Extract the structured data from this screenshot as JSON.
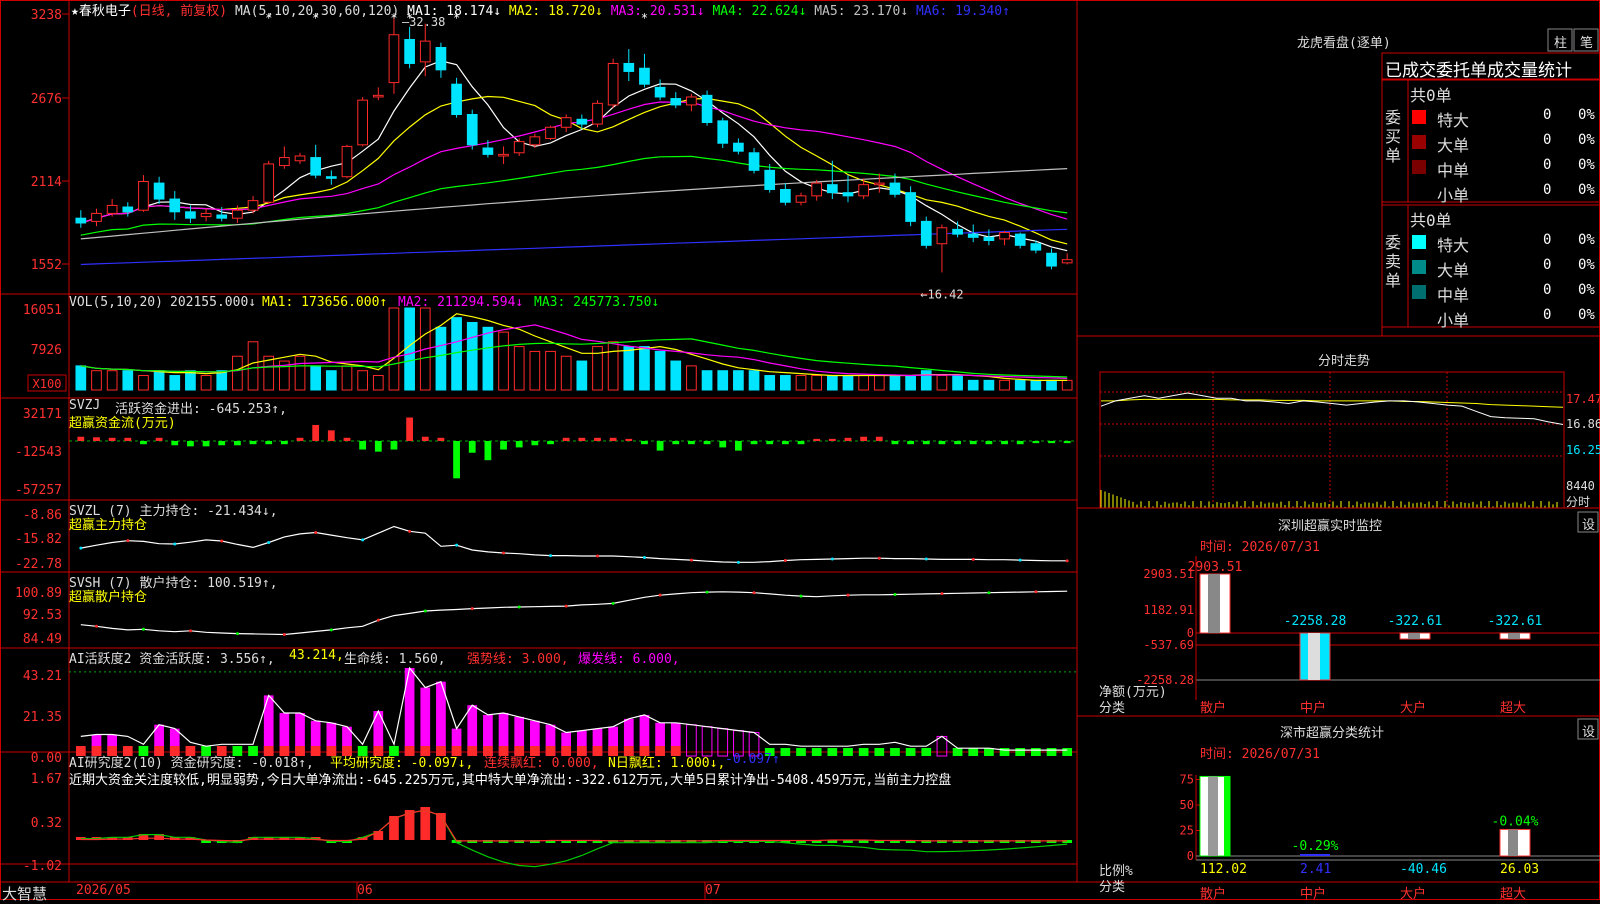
{
  "colors": {
    "up": "#ff2a2a",
    "down": "#00e5ff",
    "bg": "#000000",
    "frame": "#cc0000",
    "axis_text": "#ff3030",
    "white": "#ffffff",
    "yellow": "#ffff00",
    "magenta": "#ff00ff",
    "green": "#00ff00",
    "navy": "#3030ff",
    "gray": "#c0c0c0"
  },
  "chart_data": [
    {
      "type": "candlestick",
      "title": "★春秋电子",
      "mode": "(日线, 前复权)",
      "ma_header": "MA(5,10,20,30,60,120)",
      "ma_values": [
        {
          "label": "MA1:",
          "value": "18.174↓",
          "color": "#ffffff"
        },
        {
          "label": "MA2:",
          "value": "18.720↓",
          "color": "#ffff00"
        },
        {
          "label": "MA3:",
          "value": "20.531↓",
          "color": "#ff00ff"
        },
        {
          "label": "MA4:",
          "value": "22.624↓",
          "color": "#00ff00"
        },
        {
          "label": "MA5:",
          "value": "23.170↓",
          "color": "#c0c0c0"
        },
        {
          "label": "MA6:",
          "value": "19.340↑",
          "color": "#3030ff"
        }
      ],
      "y_ticks": [
        "3238",
        "2676",
        "2114",
        "1552"
      ],
      "high_label": "32.38",
      "low_label": "←16.42",
      "x_labels": [
        "2026/05",
        "06",
        "07"
      ],
      "ohlc": [
        [
          19.8,
          20.3,
          19.2,
          19.5
        ],
        [
          19.6,
          20.4,
          19.3,
          20.1
        ],
        [
          20.1,
          21.0,
          19.9,
          20.6
        ],
        [
          20.5,
          20.8,
          19.9,
          20.2
        ],
        [
          20.3,
          22.5,
          20.2,
          22.1
        ],
        [
          22.0,
          22.4,
          20.7,
          21.0
        ],
        [
          21.0,
          21.5,
          19.7,
          20.2
        ],
        [
          20.2,
          20.6,
          19.5,
          19.8
        ],
        [
          19.9,
          20.4,
          19.6,
          20.1
        ],
        [
          20.0,
          20.5,
          19.6,
          19.8
        ],
        [
          19.8,
          20.6,
          19.5,
          20.3
        ],
        [
          20.3,
          21.2,
          20.1,
          20.9
        ],
        [
          20.8,
          23.4,
          20.7,
          23.2
        ],
        [
          23.1,
          24.3,
          22.9,
          23.6
        ],
        [
          23.4,
          23.9,
          23.2,
          23.7
        ],
        [
          23.6,
          24.4,
          22.3,
          22.5
        ],
        [
          22.4,
          22.8,
          21.9,
          22.3
        ],
        [
          22.4,
          24.4,
          22.3,
          24.3
        ],
        [
          24.4,
          27.4,
          24.3,
          27.2
        ],
        [
          27.4,
          28.0,
          27.2,
          27.5
        ],
        [
          28.3,
          32.4,
          27.6,
          31.3
        ],
        [
          31.0,
          31.8,
          29.2,
          29.5
        ],
        [
          29.6,
          32.0,
          28.7,
          30.9
        ],
        [
          30.5,
          30.8,
          28.6,
          29.1
        ],
        [
          28.2,
          28.6,
          26.1,
          26.3
        ],
        [
          26.3,
          26.6,
          24.1,
          24.4
        ],
        [
          24.2,
          24.7,
          23.6,
          23.8
        ],
        [
          23.7,
          24.3,
          23.2,
          23.8
        ],
        [
          23.9,
          24.8,
          23.7,
          24.6
        ],
        [
          24.4,
          25.1,
          24.2,
          24.9
        ],
        [
          24.8,
          25.6,
          24.7,
          25.5
        ],
        [
          25.5,
          26.3,
          25.2,
          26.1
        ],
        [
          26.0,
          26.3,
          25.4,
          25.7
        ],
        [
          25.7,
          27.2,
          25.5,
          27.0
        ],
        [
          26.9,
          29.8,
          26.7,
          29.5
        ],
        [
          29.5,
          30.4,
          28.4,
          29.0
        ],
        [
          29.2,
          30.1,
          28.0,
          28.2
        ],
        [
          28.0,
          28.5,
          27.2,
          27.4
        ],
        [
          27.3,
          27.7,
          26.7,
          26.9
        ],
        [
          26.9,
          27.6,
          26.5,
          27.4
        ],
        [
          27.5,
          27.8,
          25.6,
          25.8
        ],
        [
          25.9,
          26.1,
          24.2,
          24.5
        ],
        [
          24.5,
          24.8,
          23.8,
          24.0
        ],
        [
          23.9,
          24.2,
          22.6,
          22.8
        ],
        [
          22.8,
          23.2,
          21.4,
          21.6
        ],
        [
          21.6,
          22.0,
          20.6,
          20.8
        ],
        [
          20.8,
          21.4,
          20.6,
          21.2
        ],
        [
          21.2,
          22.2,
          20.9,
          22.0
        ],
        [
          21.9,
          23.4,
          21.0,
          21.4
        ],
        [
          21.4,
          22.5,
          20.8,
          21.2
        ],
        [
          21.2,
          22.3,
          21.0,
          21.9
        ],
        [
          21.9,
          22.6,
          21.4,
          22.0
        ],
        [
          22.0,
          22.6,
          21.1,
          21.3
        ],
        [
          21.4,
          21.8,
          19.3,
          19.6
        ],
        [
          19.6,
          19.9,
          17.9,
          18.1
        ],
        [
          18.2,
          19.4,
          16.4,
          19.2
        ],
        [
          19.1,
          19.6,
          18.6,
          18.8
        ],
        [
          18.8,
          19.4,
          18.3,
          18.6
        ],
        [
          18.6,
          19.1,
          18.1,
          18.4
        ],
        [
          18.5,
          19.0,
          18.1,
          18.9
        ],
        [
          18.8,
          18.9,
          17.9,
          18.1
        ],
        [
          18.2,
          18.4,
          17.6,
          17.8
        ],
        [
          17.6,
          17.9,
          16.6,
          16.8
        ],
        [
          17.0,
          17.6,
          16.9,
          17.2
        ]
      ]
    },
    {
      "type": "bar",
      "title": "VOL(5,10,20)",
      "value": "202155.000↓",
      "legend": [
        {
          "label": "MA1:",
          "value": "173656.000↑",
          "color": "#ffff00"
        },
        {
          "label": "MA2:",
          "value": "211294.594↓",
          "color": "#ff00ff"
        },
        {
          "label": "MA3:",
          "value": "245773.750↓",
          "color": "#00ff00"
        }
      ],
      "y_ticks": [
        "16051",
        "7926"
      ],
      "unit_box": "X100",
      "values": [
        5,
        4,
        4,
        4,
        3,
        4,
        3,
        4,
        3,
        4,
        7,
        10,
        7,
        6,
        7,
        5,
        4,
        5,
        4,
        3,
        17,
        17,
        17,
        13,
        15,
        14,
        13,
        12,
        9,
        8,
        8,
        7,
        6,
        9,
        10,
        9,
        9,
        8,
        6,
        5,
        4,
        4,
        4,
        4,
        3,
        3,
        3,
        3,
        3,
        3,
        3,
        3,
        3,
        3,
        4,
        3,
        3,
        2,
        2,
        2,
        2,
        2,
        2,
        2
      ]
    },
    {
      "type": "bar",
      "title": "SVZJ",
      "subtitle": "超赢资金流(万元)",
      "label": "活跃资金进出:",
      "value": "-645.253↑,",
      "y_ticks": [
        "32171",
        "-12543",
        "-57257"
      ],
      "values": [
        4000,
        3500,
        3000,
        3000,
        -3000,
        3000,
        -4000,
        -5000,
        -5000,
        -4000,
        -4000,
        -3000,
        -3000,
        -3000,
        3000,
        15000,
        10000,
        3000,
        -8000,
        -10000,
        -8000,
        22000,
        4000,
        3000,
        -35000,
        -11000,
        -18000,
        -8000,
        -6000,
        -4000,
        -3000,
        3000,
        3000,
        3000,
        3000,
        2000,
        -3000,
        -9000,
        -3000,
        -3000,
        -3000,
        -6000,
        -9000,
        -3000,
        -3000,
        -3000,
        -3000,
        2000,
        2000,
        3000,
        4000,
        4000,
        -3000,
        -3000,
        -3000,
        -3000,
        -3000,
        -3000,
        -3000,
        -3000,
        -3000,
        -2000,
        -2000,
        -2000
      ]
    },
    {
      "type": "line",
      "title": "SVZL",
      "params": "(7)",
      "label": "主力持仓:",
      "value": "-21.434↓,",
      "subtitle": "超赢主力持仓",
      "y_ticks": [
        "-8.86",
        "-15.82",
        "-22.78"
      ],
      "values": [
        -18.0,
        -17.2,
        -16.5,
        -16.0,
        -16.2,
        -16.8,
        -16.9,
        -16.4,
        -15.8,
        -16.1,
        -17.0,
        -17.8,
        -16.5,
        -15.0,
        -14.2,
        -13.8,
        -14.5,
        -15.2,
        -15.8,
        -14.0,
        -12.2,
        -13.5,
        -14.0,
        -17.5,
        -17.2,
        -18.5,
        -19.0,
        -19.3,
        -19.5,
        -19.8,
        -20.0,
        -20.0,
        -20.1,
        -20.1,
        -20.1,
        -20.3,
        -20.5,
        -20.8,
        -21.0,
        -21.2,
        -21.5,
        -21.7,
        -21.8,
        -21.8,
        -21.6,
        -21.3,
        -21.1,
        -21.0,
        -20.9,
        -20.8,
        -20.7,
        -20.7,
        -20.8,
        -20.8,
        -20.9,
        -21.0,
        -21.0,
        -21.0,
        -21.1,
        -21.1,
        -21.2,
        -21.3,
        -21.4,
        -21.4
      ]
    },
    {
      "type": "line",
      "title": "SVSH",
      "params": "(7)",
      "label": "散户持仓:",
      "value": "100.519↑,",
      "subtitle": "超赢散户持仓",
      "y_ticks": [
        "100.89",
        "92.53",
        "84.49"
      ],
      "values": [
        89.5,
        89.0,
        88.3,
        87.8,
        88.0,
        87.5,
        87.2,
        87.5,
        87.0,
        86.8,
        86.6,
        86.5,
        86.4,
        86.3,
        86.8,
        87.3,
        87.8,
        88.5,
        89.0,
        91.0,
        92.5,
        93.2,
        94.0,
        94.3,
        94.5,
        94.8,
        95.0,
        95.2,
        95.3,
        95.4,
        95.5,
        95.6,
        96.0,
        96.2,
        96.5,
        97.5,
        98.5,
        99.2,
        99.6,
        100.0,
        100.2,
        100.3,
        100.2,
        100.0,
        99.6,
        99.2,
        98.9,
        98.7,
        99.0,
        99.2,
        99.3,
        99.3,
        99.4,
        99.5,
        99.6,
        99.7,
        99.8,
        99.9,
        100.0,
        100.1,
        100.2,
        100.3,
        100.4,
        100.5
      ]
    },
    {
      "type": "bar",
      "title": "AI活跃度2",
      "label": "资金活跃度:",
      "value": "3.556↑,",
      "extra": "43.214,",
      "life_label": "生命线:",
      "life_value": "1.560,",
      "strong": "强势线: 3.000,",
      "burst": "爆发线: 6.000,",
      "y_ticks": [
        "43.21",
        "21.35",
        "0.00"
      ],
      "values": [
        10,
        11,
        11,
        10,
        6,
        16,
        14,
        7,
        5,
        6,
        6,
        6,
        31,
        22,
        22,
        18,
        17,
        15,
        6,
        23,
        6,
        45,
        35,
        38,
        14,
        26,
        21,
        22,
        20,
        18,
        16,
        12,
        13,
        14,
        15,
        19,
        21,
        17,
        17,
        16,
        15,
        14,
        13,
        12,
        6,
        6,
        5,
        5,
        5,
        5,
        6,
        6,
        7,
        5,
        5,
        10,
        4,
        4,
        4,
        3,
        3,
        3,
        3,
        3
      ]
    },
    {
      "type": "bar",
      "title": "AI研究度2(10)",
      "label": "资金研究度:",
      "value": "-0.018↑,",
      "avg_label": "平均研究度:",
      "avg_value": "-0.097↓,",
      "cont_label": "连续飘红:",
      "cont_value": "0.000,",
      "n_label": "N日飘红:",
      "n_value": "1.000↓,",
      "tail": "-0.097↑",
      "note": "近期大资金关注度较低,明显弱势,今日大单净流出:-645.225万元,其中特大单净流出:-322.612万元,大单5日累计净出-5408.459万元,当前主力控盘",
      "y_ticks": [
        "1.67",
        "0.32",
        "-1.02"
      ],
      "values": [
        0.05,
        0.05,
        0.1,
        0.1,
        0.2,
        0.2,
        0.1,
        0.1,
        0.0,
        -0.05,
        -0.1,
        0.1,
        0.1,
        0.1,
        0.1,
        0.05,
        -0.05,
        -0.05,
        0.1,
        0.3,
        0.8,
        1.0,
        1.1,
        0.9,
        -0.1,
        -0.1,
        -0.1,
        -0.1,
        -0.1,
        -0.1,
        -0.05,
        -0.05,
        -0.05,
        -0.05,
        -0.1,
        -0.1,
        -0.1,
        -0.1,
        -0.1,
        -0.1,
        -0.1,
        -0.05,
        -0.05,
        -0.05,
        -0.05,
        -0.05,
        -0.05,
        -0.05,
        0.0,
        0.0,
        0.0,
        -0.05,
        -0.05,
        -0.05,
        -0.1,
        -0.1,
        -0.1,
        -0.1,
        -0.1,
        -0.1,
        -0.1,
        -0.1,
        -0.1,
        -0.1
      ]
    },
    {
      "type": "line",
      "title": "分时走势",
      "y_ticks": [
        "17.47",
        "16.86",
        "16.25",
        "8440"
      ],
      "unit": "分时",
      "price": [
        17.2,
        17.3,
        17.35,
        17.4,
        17.35,
        17.4,
        17.45,
        17.4,
        17.35,
        17.35,
        17.3,
        17.3,
        17.28,
        17.25,
        17.3,
        17.28,
        17.25,
        17.22,
        17.25,
        17.28,
        17.3,
        17.3,
        17.28,
        17.25,
        17.22,
        17.2,
        17.1,
        17.0,
        16.98,
        16.97,
        16.96,
        16.9,
        16.85
      ],
      "avg": [
        17.3,
        17.3,
        17.32,
        17.33,
        17.33,
        17.33,
        17.33,
        17.33,
        17.33,
        17.32,
        17.32,
        17.32,
        17.31,
        17.31,
        17.31,
        17.3,
        17.3,
        17.3,
        17.3,
        17.3,
        17.3,
        17.29,
        17.29,
        17.28,
        17.27,
        17.26,
        17.25,
        17.23,
        17.22,
        17.21,
        17.2,
        17.19,
        17.18
      ]
    },
    {
      "type": "bar",
      "title": "深圳超赢实时监控",
      "time": "时间: 2026/07/31",
      "y_ticks": [
        "2903.51",
        "1182.91",
        "0",
        "-537.69",
        "-2258.28"
      ],
      "ylabel": "净额(万元)",
      "xlabel": "分类",
      "categories": [
        "散户",
        "中户",
        "大户",
        "超大"
      ],
      "values": [
        2903.51,
        -2258.28,
        -322.61,
        -322.61
      ],
      "value_labels": [
        "2903.51",
        "-2258.28",
        "-322.61",
        "-322.61"
      ]
    },
    {
      "type": "bar",
      "title": "深市超赢分类统计",
      "time": "时间: 2026/07/31",
      "y_ticks": [
        "75",
        "50",
        "25",
        "0"
      ],
      "ylabel": "比例%",
      "xlabel": "分类",
      "categories": [
        "散户",
        "中户",
        "大户",
        "超大"
      ],
      "values": [
        75,
        2.41,
        0,
        26.03
      ],
      "top_labels": [
        "",
        "-0.29%",
        "",
        "-0.04%"
      ],
      "bottom_labels": [
        "112.02",
        "2.41",
        "-40.46",
        "26.03"
      ]
    }
  ],
  "dragon_panel": {
    "title": "龙虎看盘(逐单)",
    "btn_bar": "柱",
    "btn_pen": "笔",
    "subtitle": "已成交委托单成交量统计",
    "buy_title": "委买单",
    "sell_title": "委卖单",
    "buy_total": "共0单",
    "sell_total": "共0单",
    "buy_rows": [
      {
        "name": "特大",
        "count": "0",
        "pct": "0%",
        "color": "#ff0000"
      },
      {
        "name": "大单",
        "count": "0",
        "pct": "0%",
        "color": "#990000"
      },
      {
        "name": "中单",
        "count": "0",
        "pct": "0%",
        "color": "#7a0000"
      },
      {
        "name": "小单",
        "count": "0",
        "pct": "0%",
        "color": ""
      }
    ],
    "sell_rows": [
      {
        "name": "特大",
        "count": "0",
        "pct": "0%",
        "color": "#00ffff"
      },
      {
        "name": "大单",
        "count": "0",
        "pct": "0%",
        "color": "#008b8b"
      },
      {
        "name": "中单",
        "count": "0",
        "pct": "0%",
        "color": "#006e6e"
      },
      {
        "name": "小单",
        "count": "0",
        "pct": "0%",
        "color": ""
      }
    ]
  },
  "settings_label": "设",
  "brand": "大智慧",
  "x_times": [
    "2026/05",
    "06",
    "07"
  ]
}
